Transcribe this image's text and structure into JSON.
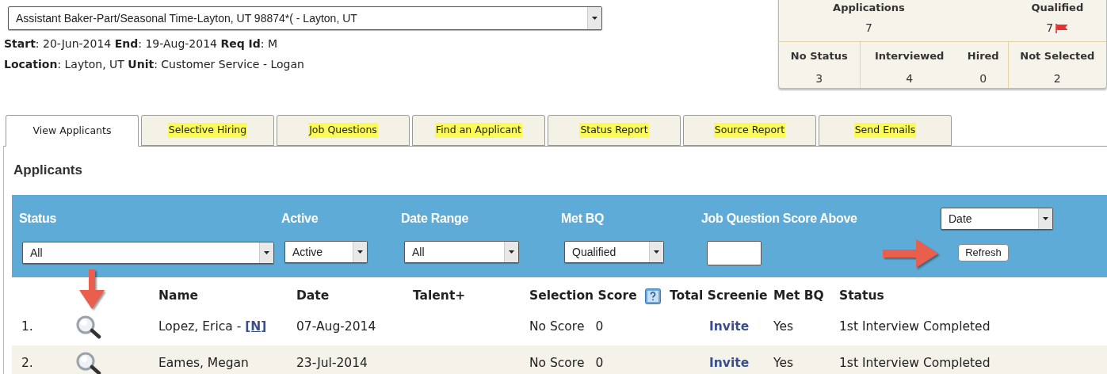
{
  "job_select": {
    "value": "Assistant Baker-Part/Seasonal Time-Layton, UT 98874*( - Layton, UT"
  },
  "details": [
    "**Start**: 20-Jun-2014 **End**: 19-Aug-2014 **Req Id**: M",
    "**Location**: Layton, UT **Unit**: Customer Service - Logan"
  ],
  "stats": {
    "top": [
      {
        "label": "Applications",
        "value": "7",
        "flag": false
      },
      {
        "label": "Qualified",
        "value": "7",
        "flag": true
      }
    ],
    "bottom": [
      {
        "label": "No Status",
        "value": "3"
      },
      {
        "label": "Interviewed",
        "value": "4"
      },
      {
        "label": "Hired",
        "value": "0"
      },
      {
        "label": "Not Selected",
        "value": "2"
      }
    ]
  },
  "tabs": [
    {
      "label": "View Applicants",
      "selected": true
    },
    {
      "label": "Selective Hiring",
      "selected": false
    },
    {
      "label": "Job Questions",
      "selected": false
    },
    {
      "label": "Find an Applicant",
      "selected": false
    },
    {
      "label": "Status Report",
      "selected": false
    },
    {
      "label": "Source Report",
      "selected": false
    },
    {
      "label": "Send Emails",
      "selected": false
    }
  ],
  "section_title": "Applicants",
  "filters": [
    {
      "label": "Status",
      "kind": "select",
      "value": "All"
    },
    {
      "label": "Active",
      "kind": "select",
      "value": "Active"
    },
    {
      "label": "Date Range",
      "kind": "select",
      "value": "All"
    },
    {
      "label": "Met BQ",
      "kind": "select",
      "value": "Qualified"
    },
    {
      "label": "Job Question Score Above",
      "kind": "input"
    }
  ],
  "sort_select": {
    "value": "Date"
  },
  "refresh_button": "Refresh",
  "table": {
    "columns": [
      "Name",
      "Date",
      "Talent+",
      "Selection Score",
      "Total Screenie",
      "Met BQ",
      "Status"
    ],
    "rows": [
      {
        "number": "1.",
        "name": "Lopez, Erica -",
        "tag": "[N]",
        "date": "07-Aug-2014",
        "selection_score": "No Score",
        "score": "0",
        "screenie": "Invite",
        "met_bq": "Yes",
        "status": "1st Interview Completed"
      },
      {
        "number": "2.",
        "name": "Eames, Megan",
        "date": "23-Jul-2014",
        "selection_score": "No Score",
        "score": "0",
        "screenie": "Invite",
        "met_bq": "Yes",
        "status": "1st Interview Completed"
      }
    ]
  }
}
